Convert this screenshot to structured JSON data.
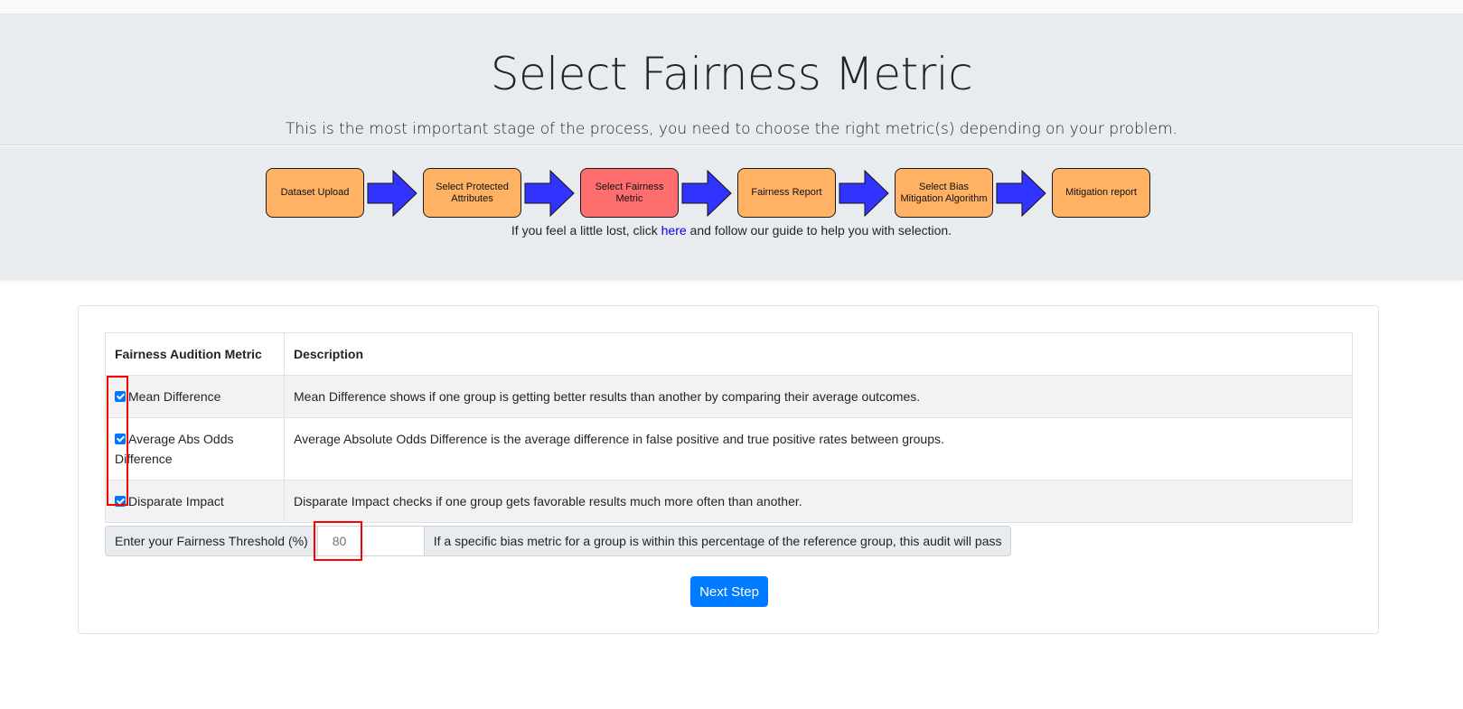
{
  "header": {
    "title": "Select Fairness Metric",
    "lead": "This is the most important stage of the process, you need to choose the right metric(s) depending on your problem."
  },
  "steps": [
    {
      "label": "Dataset Upload",
      "active": false
    },
    {
      "label": "Select Protected Attributes",
      "active": false
    },
    {
      "label": "Select Fairness Metric",
      "active": true
    },
    {
      "label": "Fairness Report",
      "active": false
    },
    {
      "label": "Select Bias Mitigation Algorithm",
      "active": false
    },
    {
      "label": "Mitigation report",
      "active": false
    }
  ],
  "guide": {
    "before": "If you feel a little lost, click ",
    "link": "here",
    "after": " and follow our guide to help you with selection."
  },
  "table": {
    "headers": [
      "Fairness Audition Metric",
      "Description"
    ],
    "rows": [
      {
        "metric": "Mean Difference",
        "checked": true,
        "description": "Mean Difference shows if one group is getting better results than another by comparing their average outcomes."
      },
      {
        "metric": "Average Abs Odds Difference",
        "checked": true,
        "description": "Average Absolute Odds Difference is the average difference in false positive and true positive rates between groups."
      },
      {
        "metric": "Disparate Impact",
        "checked": true,
        "description": "Disparate Impact checks if one group gets favorable results much more often than another."
      }
    ]
  },
  "threshold": {
    "label": "Enter your Fairness Threshold (%)",
    "value": "80",
    "hint": "If a specific bias metric for a group is within this percentage of the reference group, this audit will pass"
  },
  "buttons": {
    "next": "Next Step"
  },
  "colors": {
    "step": "#ffb264",
    "step_active": "#ff6e6e",
    "arrow": "#3333ff",
    "primary": "#007bff",
    "highlight": "#ff0000"
  }
}
